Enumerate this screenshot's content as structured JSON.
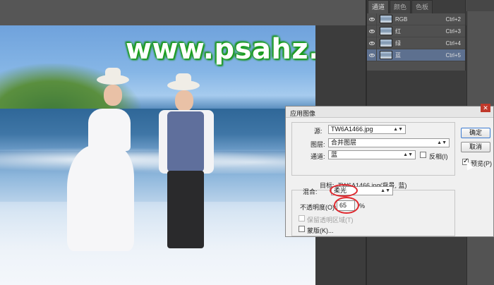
{
  "watermark": "www.psahz.com",
  "channels_panel": {
    "tabs": [
      {
        "label": "通道",
        "active": true
      },
      {
        "label": "颜色",
        "active": false
      },
      {
        "label": "色板",
        "active": false
      }
    ],
    "rows": [
      {
        "name": "RGB",
        "shortcut": "Ctrl+2",
        "selected": false
      },
      {
        "name": "红",
        "shortcut": "Ctrl+3",
        "selected": false
      },
      {
        "name": "绿",
        "shortcut": "Ctrl+4",
        "selected": false
      },
      {
        "name": "蓝",
        "shortcut": "Ctrl+5",
        "selected": true
      }
    ]
  },
  "dialog": {
    "title": "应用图像",
    "source_label": "源:",
    "source_value": "TW6A1466.jpg",
    "layer_label": "图层:",
    "layer_value": "合并图层",
    "channel_label": "通道:",
    "channel_value": "蓝",
    "invert_label": "反相(I)",
    "target_label": "目标:",
    "target_value": "TW6A1466.jpg(背景, 蓝)",
    "blending_label": "混合:",
    "blending_value": "柔光",
    "opacity_label": "不透明度(O):",
    "opacity_value": "65",
    "opacity_unit": "%",
    "preserve_label": "保留透明区域(T)",
    "mask_label": "蒙版(K)...",
    "ok_button": "确定",
    "cancel_button": "取消",
    "preview_label": "预览(P)",
    "preview_checked": true
  },
  "colors": {
    "selected_channel": "#5d708f",
    "annotation_red": "#e0282e",
    "watermark_green": "#1ba51b"
  }
}
